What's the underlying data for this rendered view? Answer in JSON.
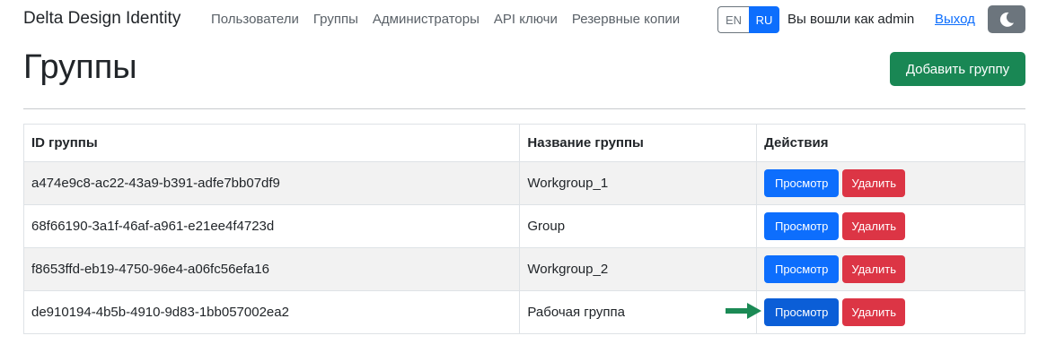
{
  "navbar": {
    "brand": "Delta Design Identity",
    "links": [
      "Пользователи",
      "Группы",
      "Администраторы",
      "API ключи",
      "Резервные копии"
    ],
    "lang_en": "EN",
    "lang_ru": "RU",
    "logged_in_text": "Вы вошли как admin",
    "logout": "Выход"
  },
  "page": {
    "title": "Группы",
    "add_button": "Добавить группу"
  },
  "table": {
    "headers": [
      "ID группы",
      "Название группы",
      "Действия"
    ],
    "rows": [
      {
        "id": "a474e9c8-ac22-43a9-b391-adfe7bb07df9",
        "name": "Workgroup_1"
      },
      {
        "id": "68f66190-3a1f-46af-a961-e21ee4f4723d",
        "name": "Group"
      },
      {
        "id": "f8653ffd-eb19-4750-96e4-a06fc56efa16",
        "name": "Workgroup_2"
      },
      {
        "id": "de910194-4b5b-4910-9d83-1bb057002ea2",
        "name": "Рабочая группа"
      }
    ],
    "view_label": "Просмотр",
    "delete_label": "Удалить"
  },
  "colors": {
    "primary": "#0d6efd",
    "success": "#198754",
    "danger": "#dc3545",
    "secondary": "#6c757d",
    "arrow": "#1b8a55"
  },
  "icons": {
    "theme_toggle": "moon-icon",
    "pointer": "arrow-right-icon"
  }
}
